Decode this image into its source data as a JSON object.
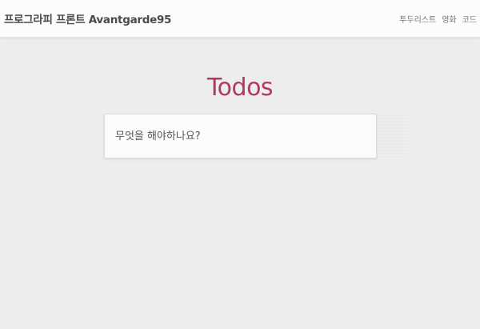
{
  "navbar": {
    "brand": "프로그라피 프론트 Avantgarde95",
    "links": [
      "투두리스트",
      "영화",
      "코드"
    ]
  },
  "main": {
    "title": "Todos",
    "input_placeholder": "무엇을 해야하나요?",
    "input_value": ""
  },
  "colors": {
    "accent": "#b03a5b",
    "background": "#eeedee",
    "navbar": "#fdfcfd"
  }
}
